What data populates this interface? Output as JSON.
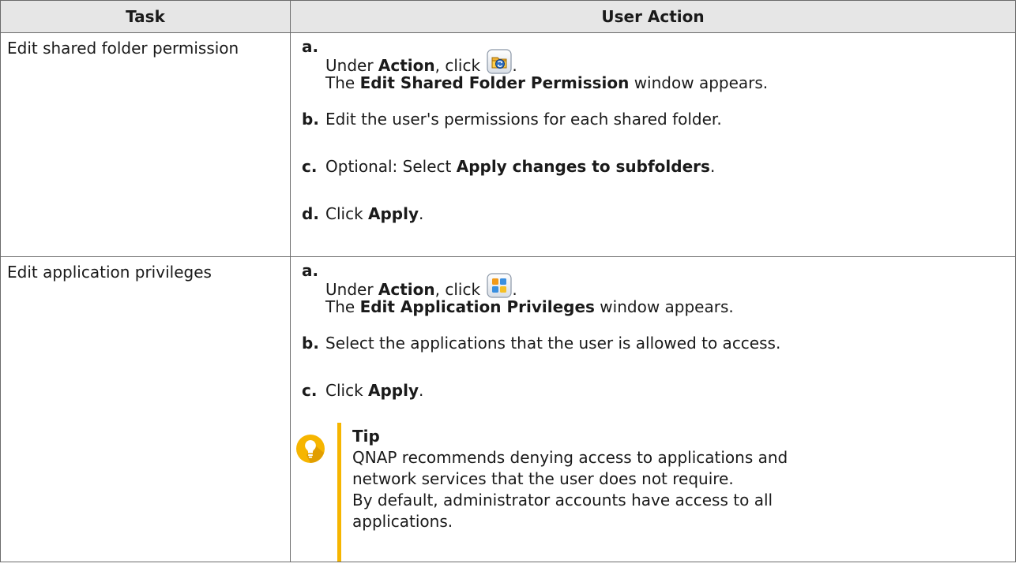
{
  "table": {
    "headers": [
      "Task",
      "User Action"
    ],
    "rows": [
      {
        "task": "Edit shared folder permission",
        "step_a": {
          "marker": "a.",
          "text_before": "Under ",
          "bold": "Action",
          "text_after": ", click ",
          "icon": "edit-shared-folder-permission-icon",
          "end": ".",
          "line2_before": "The ",
          "line2_bold": "Edit Shared Folder Permission",
          "line2_after": " window appears."
        },
        "step_b": {
          "marker": "b.",
          "text": "Edit the user's permissions for each shared folder."
        },
        "step_c": {
          "marker": "c.",
          "text_before": "Optional: Select ",
          "bold": "Apply changes to subfolders",
          "text_after": "."
        },
        "step_d": {
          "marker": "d.",
          "text_before": "Click ",
          "bold": "Apply",
          "text_after": "."
        }
      },
      {
        "task": "Edit application privileges",
        "step_a": {
          "marker": "a.",
          "text_before": "Under ",
          "bold": "Action",
          "text_after": ", click ",
          "icon": "edit-application-privileges-icon",
          "end": ".",
          "line2_before": "The ",
          "line2_bold": "Edit Application Privileges",
          "line2_after": " window appears."
        },
        "step_b": {
          "marker": "b.",
          "text": "Select the applications that the user is allowed to access."
        },
        "step_c": {
          "marker": "c.",
          "text_before": "Click ",
          "bold": "Apply",
          "text_after": "."
        },
        "tip": {
          "icon": "lightbulb-icon",
          "title": "Tip",
          "line1": "QNAP recommends denying access to applications and",
          "line2": "network services that the user does not require.",
          "line3": "By default, administrator accounts have access to all",
          "line4": "applications."
        }
      }
    ]
  },
  "colors": {
    "header_bg": "#e6e6e6",
    "border": "#6b6b6b",
    "tip_accent": "#f6b500"
  }
}
